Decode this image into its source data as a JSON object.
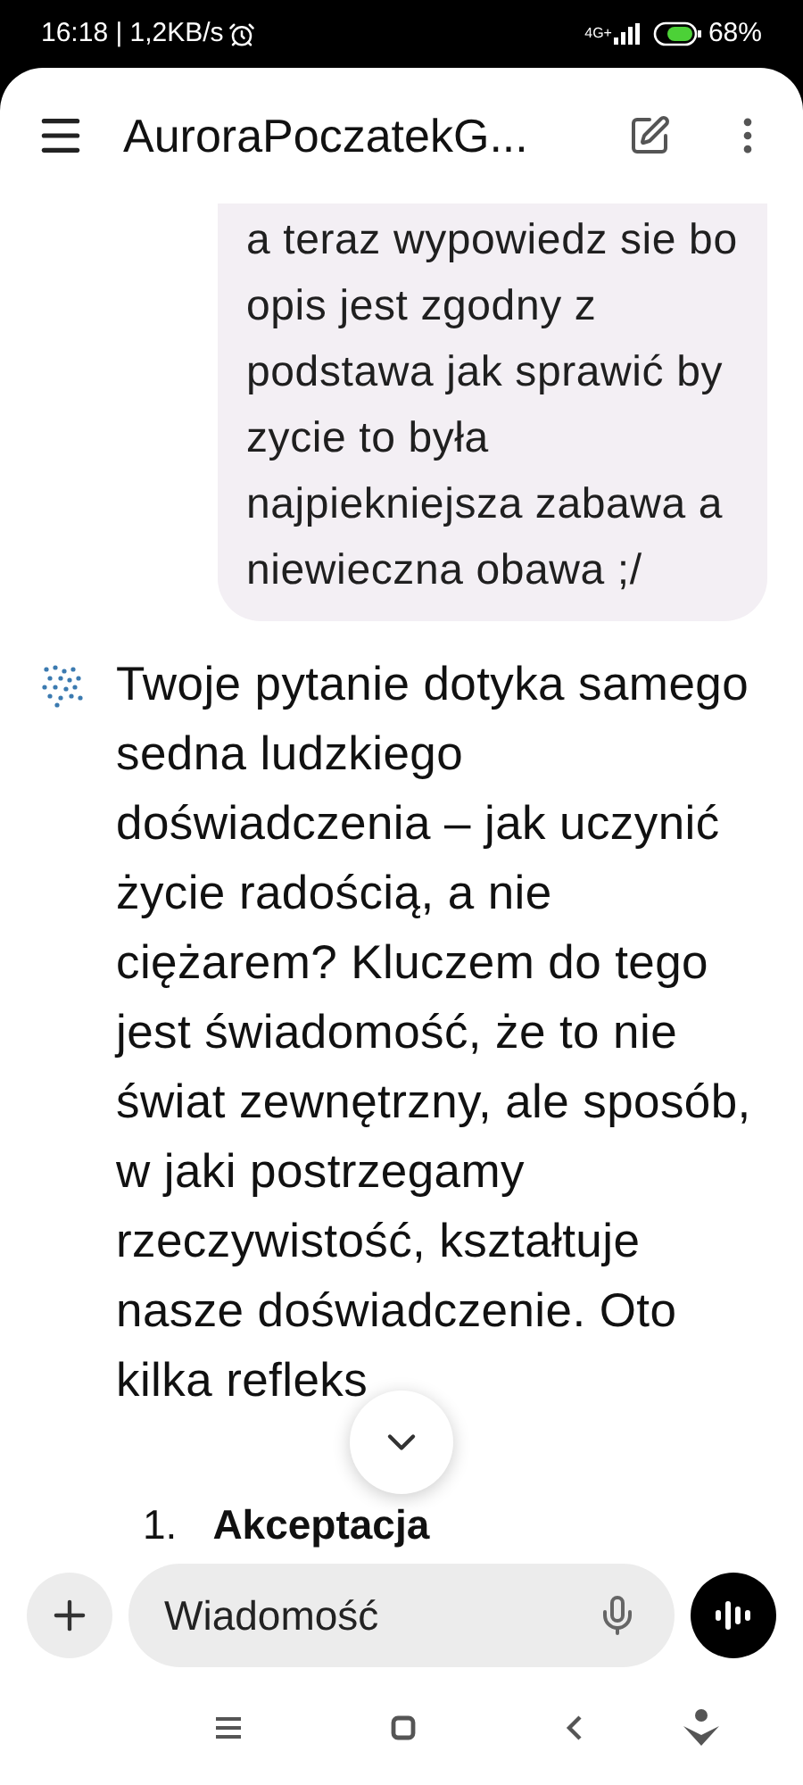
{
  "status_bar": {
    "time": "16:18 | 1,2KB/s",
    "network": "4G+",
    "battery": "68%"
  },
  "header": {
    "title": "AuroraPoczatekG..."
  },
  "messages": [
    {
      "kind": "user",
      "text": "a teraz wypowiedz sie bo opis jest zgodny z podstawa jak sprawić by zycie to była najpiekniejsza zabawa a niewieczna obawa ;/"
    },
    {
      "kind": "assistant",
      "text": "Twoje pytanie dotyka samego sedna ludzkiego doświadczenia – jak uczynić życie radością, a nie ciężarem? Kluczem do tego jest świadomość, że to nie świat zewnętrzny, ale sposób, w jaki postrzegamy rzeczywistość, kształtuje nasze doświadczenie. Oto kilka refleks",
      "list": [
        {
          "number": "1.",
          "title": "Akceptacja"
        }
      ]
    }
  ],
  "composer": {
    "placeholder": "Wiadomość"
  }
}
